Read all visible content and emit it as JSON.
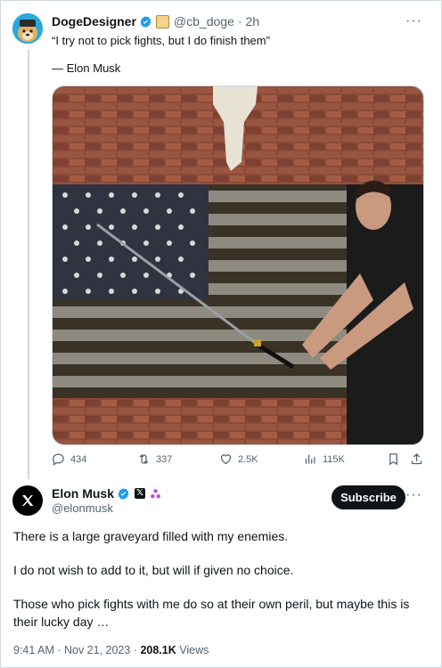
{
  "quoted_tweet": {
    "author_name": "DogeDesigner",
    "handle": "@cb_doge",
    "time": "2h",
    "text": "“I try not to pick fights, but I do finish them”",
    "attribution": "— Elon Musk",
    "actions": {
      "replies": "434",
      "reposts": "337",
      "likes": "2.5K",
      "views": "115K"
    }
  },
  "main_tweet": {
    "author_name": "Elon Musk",
    "handle": "@elonmusk",
    "subscribe_label": "Subscribe",
    "paragraphs": [
      "There is a large graveyard filled with my enemies.",
      "I do not wish to add to it, but will if given no choice.",
      "Those who pick fights with me do so at their own peril, but maybe this is their lucky day …"
    ],
    "timestamp": "9:41 AM · Nov 21, 2023 ·",
    "views_count": "208.1K",
    "views_label": "Views"
  },
  "icons": {
    "verified": "verified-badge-icon",
    "more": "more-icon",
    "reply": "reply-icon",
    "repost": "repost-icon",
    "like": "like-icon",
    "views": "views-icon",
    "bookmark": "bookmark-icon",
    "share": "share-icon"
  },
  "colors": {
    "verified_blue": "#1d9bf0",
    "text_primary": "#0f1419",
    "text_secondary": "#536471",
    "border": "#cfd9de"
  }
}
